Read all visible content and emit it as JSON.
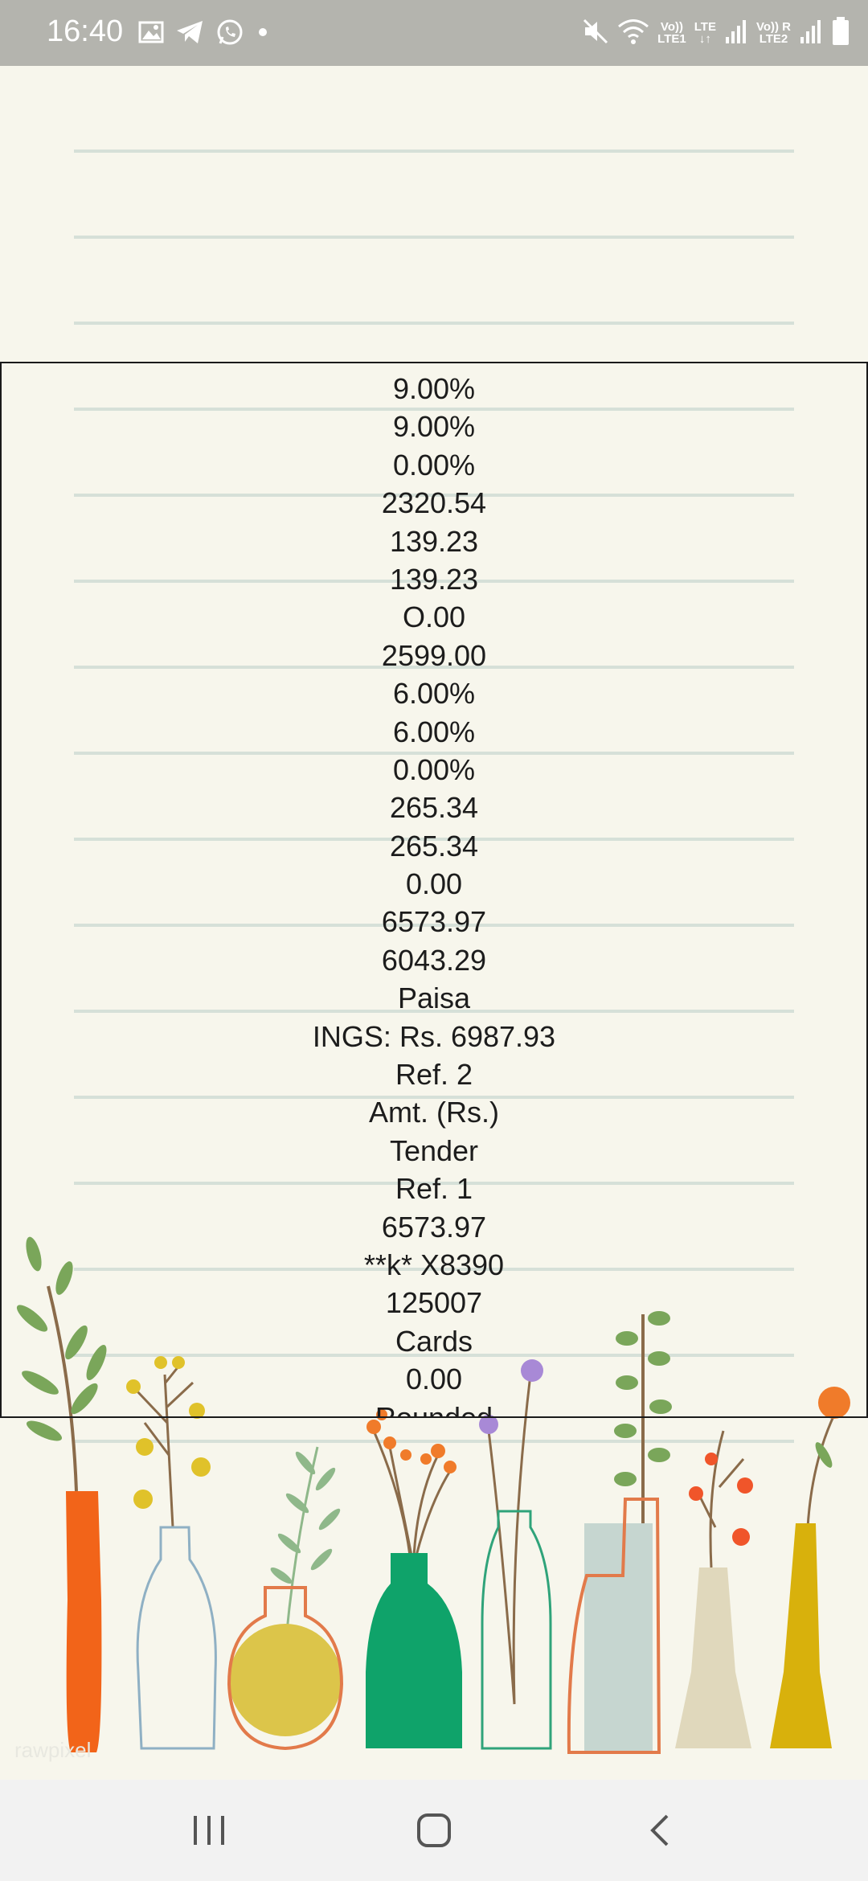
{
  "status_bar": {
    "time": "16:40",
    "left_icons": [
      "gallery-icon",
      "telegram-icon",
      "whatsapp-icon",
      "dot-icon"
    ],
    "right_icons": [
      "mute-icon",
      "wifi-icon",
      "volte-lte1-icon",
      "lte-icon",
      "signal-icon",
      "volte-lte2-icon",
      "signal-roaming-icon",
      "battery-icon"
    ],
    "volte1_top": "Vo))",
    "volte1_bottom": "LTE1",
    "lte_label": "LTE",
    "volte2_top": "Vo)) R",
    "volte2_bottom": "LTE2"
  },
  "receipt_lines": [
    "9.00%",
    "9.00%",
    "0.00%",
    "2320.54",
    "139.23",
    "139.23",
    "O.00",
    "2599.00",
    "6.00%",
    "6.00%",
    "0.00%",
    "265.34",
    "265.34",
    "0.00",
    "6573.97",
    "6043.29",
    "Paisa",
    "INGS: Rs. 6987.93",
    "Ref. 2",
    "Amt. (Rs.)",
    "Tender",
    "Ref. 1",
    "6573.97",
    "**k* X8390",
    "125007",
    "Cards",
    "0.00",
    "Rounded"
  ],
  "watermark": "rawpixel",
  "nav_bar": {
    "buttons": [
      "recent-apps",
      "home",
      "back"
    ]
  },
  "colors": {
    "status_bar": "#b4b4ae",
    "background": "#f7f6ec",
    "ruled_line": "#d6e0d8",
    "nav_bar": "#f2f2f2"
  }
}
